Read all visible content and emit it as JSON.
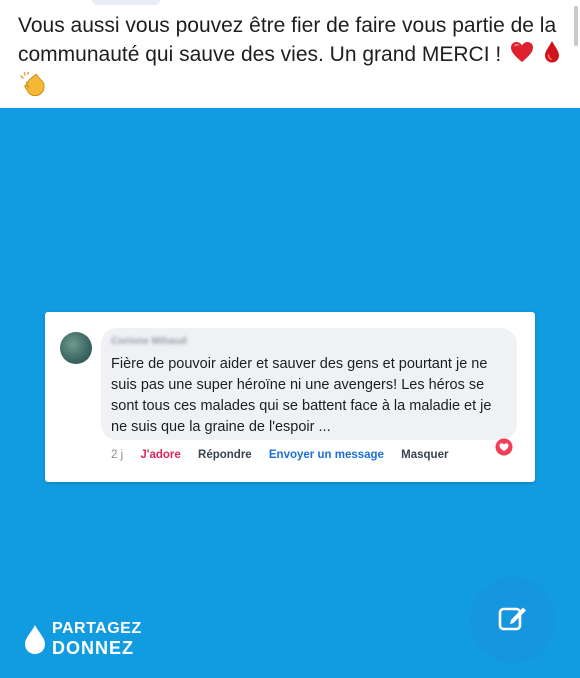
{
  "post": {
    "text": "Vous aussi vous pouvez être fier de faire vous partie de la communauté qui sauve des vies.  Un grand MERCI !",
    "emojis": [
      "red-heart-icon",
      "blood-drop-icon",
      "clapping-hands-icon"
    ]
  },
  "hero": {
    "background_color": "#119be0",
    "comment": {
      "author": "Corinne Mihaud",
      "text": "Fière de pouvoir aider et sauver des gens et pourtant je ne suis pas une super héroïne ni une avengers! Les héros se sont tous ces malades qui se battent face à la maladie et je ne suis que la graine de l'espoir ...",
      "time": "2 j",
      "love_label": "J'adore",
      "reply_label": "Répondre",
      "message_label": "Envoyer un message",
      "hide_label": "Masquer",
      "reaction_icon": "love-reaction-icon"
    },
    "logo": {
      "line1": "PARTAGEZ",
      "line2": "DONNEZ"
    }
  },
  "fab": {
    "icon": "edit-icon"
  }
}
